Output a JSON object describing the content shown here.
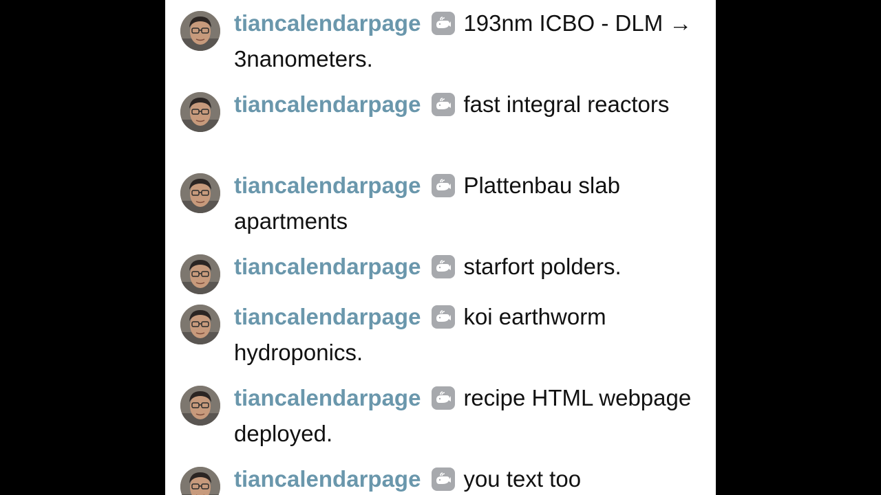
{
  "chat": {
    "messages": [
      {
        "username": "tiancalendarpage",
        "badge_icon": "whale-badge-icon",
        "text": "193nm ICBO - DLM → 3nanometers."
      },
      {
        "username": "tiancalendarpage",
        "badge_icon": "whale-badge-icon",
        "text": "fast integral reactors"
      },
      {
        "username": "tiancalendarpage",
        "badge_icon": "whale-badge-icon",
        "text": "Plattenbau slab apartments"
      },
      {
        "username": "tiancalendarpage",
        "badge_icon": "whale-badge-icon",
        "text": "starfort polders."
      },
      {
        "username": "tiancalendarpage",
        "badge_icon": "whale-badge-icon",
        "text": "koi earthworm hydroponics."
      },
      {
        "username": "tiancalendarpage",
        "badge_icon": "whale-badge-icon",
        "text": "recipe HTML webpage deployed."
      },
      {
        "username": "tiancalendarpage",
        "badge_icon": "whale-badge-icon",
        "text": "you text too"
      }
    ]
  },
  "colors": {
    "username": "#6a97ac",
    "badge": "#a7a9ad",
    "background": "#ffffff",
    "letterbox": "#000000"
  }
}
